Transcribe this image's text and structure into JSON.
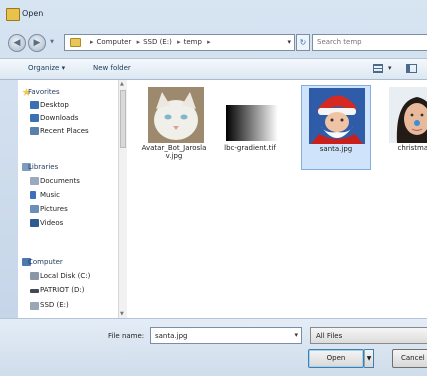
{
  "window": {
    "title": "Open"
  },
  "address": {
    "crumbs": [
      "Computer",
      "SSD (E:)",
      "temp"
    ],
    "refresh_icon": "refresh-icon"
  },
  "search": {
    "placeholder": "Search temp"
  },
  "toolbar": {
    "organize_label": "Organize ▾",
    "new_folder_label": "New folder"
  },
  "nav": {
    "favorites": {
      "label": "Favorites",
      "items": [
        "Desktop",
        "Downloads",
        "Recent Places"
      ]
    },
    "libraries": {
      "label": "Libraries",
      "items": [
        "Documents",
        "Music",
        "Pictures",
        "Videos"
      ]
    },
    "computer": {
      "label": "Computer",
      "items": [
        "Local Disk (C:)",
        "PATRIOT (D:)",
        "SSD (E:)"
      ]
    }
  },
  "files": [
    {
      "name": "Avatar_Bot_Jaroslav.jpg",
      "selected": false
    },
    {
      "name": "lbc-gradient.tif",
      "selected": false
    },
    {
      "name": "santa.jpg",
      "selected": true
    },
    {
      "name": "christmas...",
      "selected": false
    }
  ],
  "filename": {
    "label": "File name:",
    "value": "santa.jpg"
  },
  "filter": {
    "value": "All Files"
  },
  "buttons": {
    "open_label": "Open",
    "cancel_label": "Cancel"
  }
}
